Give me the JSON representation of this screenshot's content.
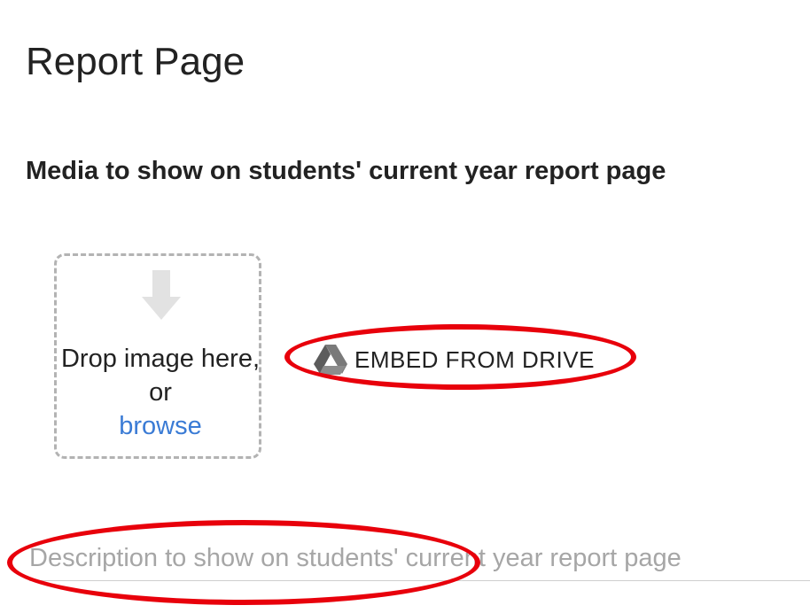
{
  "page": {
    "title": "Report Page"
  },
  "media_section": {
    "heading": "Media to show on students' current year report page"
  },
  "dropzone": {
    "text": "Drop image here, or",
    "browse_label": "browse",
    "icon": "download-arrow-icon"
  },
  "embed": {
    "label": "EMBED FROM DRIVE",
    "icon": "google-drive-icon"
  },
  "description": {
    "placeholder": "Description to show on students' current year report page",
    "value": ""
  },
  "annotations": {
    "color": "#e8000b"
  },
  "colors": {
    "text": "#222222",
    "link": "#3a7bd5",
    "placeholder": "#a6a6a6",
    "dashed_border": "#b3b3b3"
  }
}
